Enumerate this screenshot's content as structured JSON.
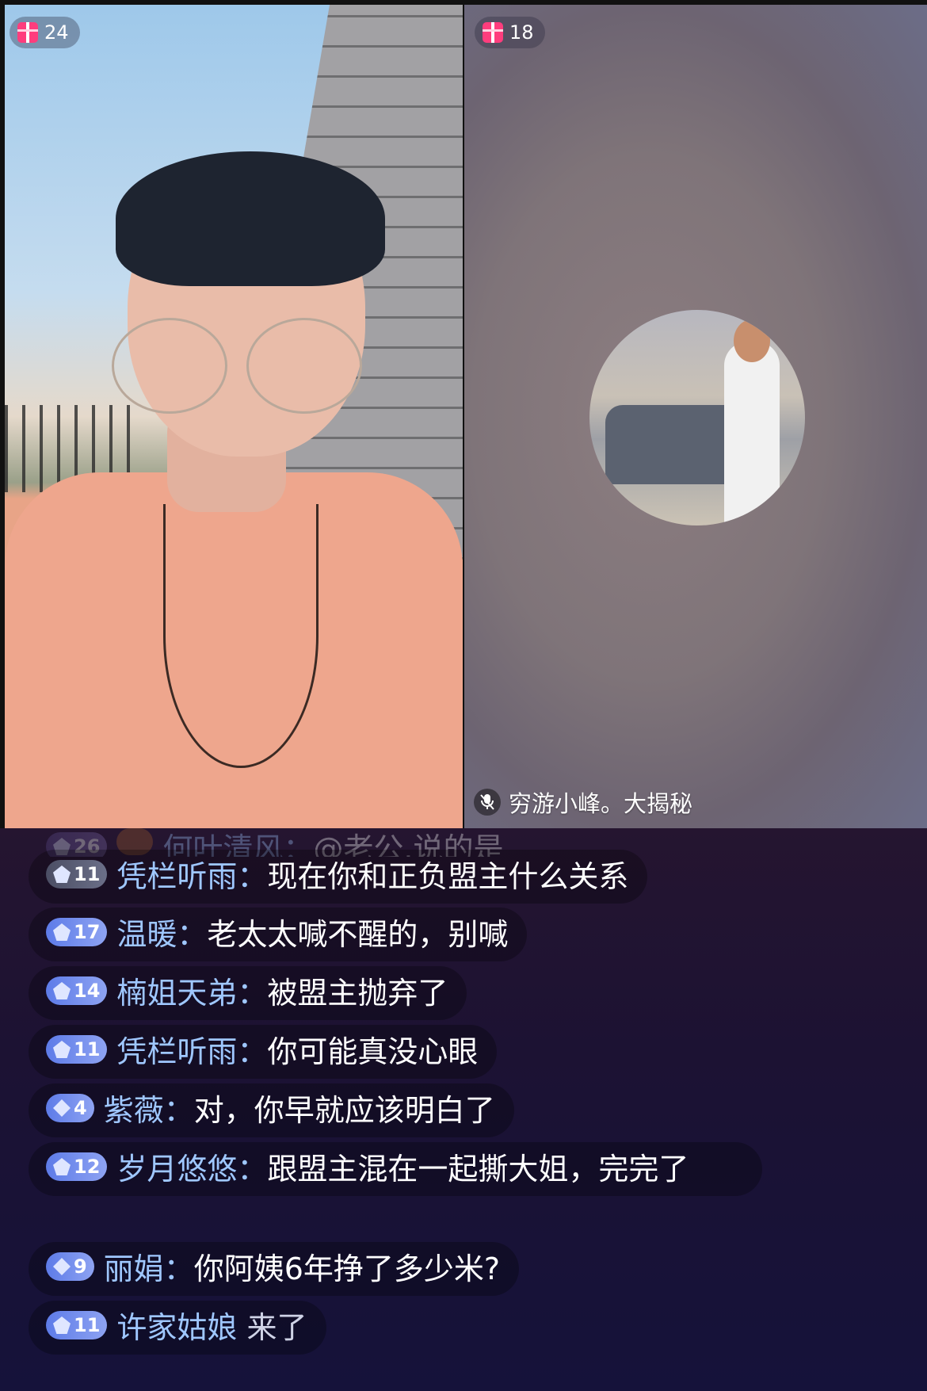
{
  "streams": {
    "left": {
      "gift_count": "24"
    },
    "right": {
      "gift_count": "18",
      "host_name": "穷游小峰。大揭秘",
      "mic_status": "muted"
    }
  },
  "chat": [
    {
      "level": "26",
      "badge": "bronze",
      "name": "何叶清风：",
      "text": "@老公.说的是",
      "faded": true
    },
    {
      "level": "11",
      "badge": "gray",
      "name": "凭栏听雨：",
      "text": "现在你和正负盟主什么关系"
    },
    {
      "level": "17",
      "badge": "blue",
      "name": "温暖：",
      "text": "老太太喊不醒的，别喊"
    },
    {
      "level": "14",
      "badge": "blue",
      "name": "楠姐天弟：",
      "text": "被盟主抛弃了"
    },
    {
      "level": "11",
      "badge": "blue",
      "name": "凭栏听雨：",
      "text": "你可能真没心眼"
    },
    {
      "level": "4",
      "badge": "diamond",
      "name": "紫薇：",
      "text": "对，你早就应该明白了"
    },
    {
      "level": "12",
      "badge": "blue",
      "name": "岁月悠悠：",
      "text": "跟盟主混在一起撕大姐，完完了"
    },
    {
      "level": "9",
      "badge": "diamond",
      "name": "丽娟：",
      "text": "你阿姨6年挣了多少米?"
    },
    {
      "level": "11",
      "badge": "blue",
      "name": "许家姑娘",
      "text": "来了"
    }
  ],
  "icons": {
    "gift": "gift-icon",
    "mic": "mic-off-icon",
    "badge": "gem-icon"
  }
}
